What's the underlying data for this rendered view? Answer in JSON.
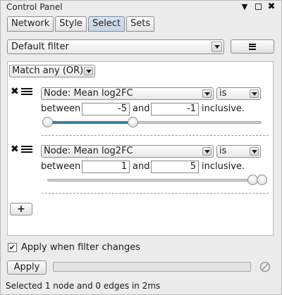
{
  "window": {
    "title": "Control Panel",
    "icons": {
      "dropdown": "triangle-down-icon",
      "maximize": "maximize-icon",
      "close": "close-icon"
    }
  },
  "tabs": [
    {
      "label": "Network",
      "active": false
    },
    {
      "label": "Style",
      "active": false
    },
    {
      "label": "Select",
      "active": true
    },
    {
      "label": "Sets",
      "active": false
    }
  ],
  "filter": {
    "selected": "Default filter",
    "menu_icon": "hamburger-menu-icon"
  },
  "match": {
    "selected": "Match any (OR)"
  },
  "criteria": [
    {
      "column": "Node: Mean log2FC",
      "operator": "is",
      "between_label": "between",
      "and_label": "and",
      "inclusive_label": "inclusive.",
      "low": "-5",
      "high": "-1",
      "slider_low_fraction": 0.0,
      "slider_high_fraction": 0.4
    },
    {
      "column": "Node: Mean log2FC",
      "operator": "is",
      "between_label": "between",
      "and_label": "and",
      "inclusive_label": "inclusive.",
      "low": "1",
      "high": "5",
      "slider_low_fraction": 0.96,
      "slider_high_fraction": 1.0
    }
  ],
  "add_button": {
    "label": "+"
  },
  "apply_on_change": {
    "label": "Apply when filter changes",
    "checked": true
  },
  "apply_button": {
    "label": "Apply"
  },
  "progress": {
    "value": 0
  },
  "status": "Selected 1 node and 0 edges in 2ms",
  "colors": {
    "slider_fill": "#3a7ea9",
    "active_tab": "#c8d4e2"
  }
}
